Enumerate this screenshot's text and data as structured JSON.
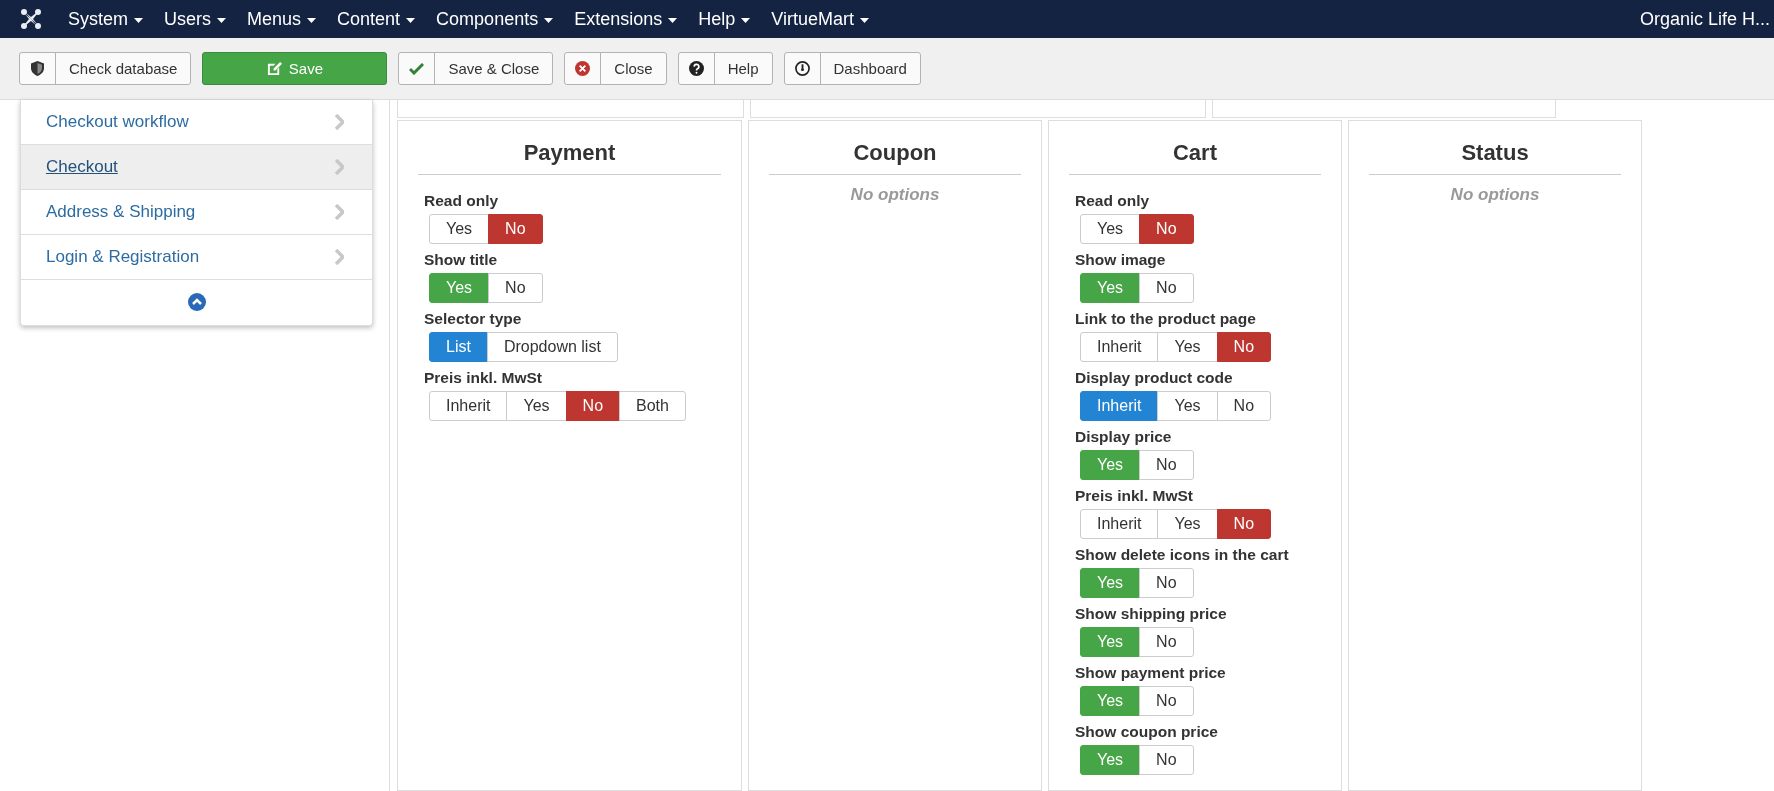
{
  "navbar": {
    "menus": [
      {
        "label": "System"
      },
      {
        "label": "Users"
      },
      {
        "label": "Menus"
      },
      {
        "label": "Content"
      },
      {
        "label": "Components"
      },
      {
        "label": "Extensions"
      },
      {
        "label": "Help"
      },
      {
        "label": "VirtueMart"
      }
    ],
    "site_name": "Organic Life H..."
  },
  "toolbar": [
    {
      "label": "Check database",
      "kind": "default"
    },
    {
      "label": "Save",
      "kind": "primary"
    },
    {
      "label": "Save & Close",
      "kind": "default"
    },
    {
      "label": "Close",
      "kind": "default"
    },
    {
      "label": "Help",
      "kind": "default"
    },
    {
      "label": "Dashboard",
      "kind": "default"
    }
  ],
  "sidebar": {
    "items": [
      {
        "label": "Checkout workflow",
        "selected": false
      },
      {
        "label": "Checkout",
        "selected": true
      },
      {
        "label": "Address & Shipping",
        "selected": false
      },
      {
        "label": "Login & Registration",
        "selected": false
      }
    ]
  },
  "panels": [
    {
      "title": "Payment",
      "options": [
        {
          "label": "Read only",
          "choices": [
            {
              "label": "Yes",
              "selected": false
            },
            {
              "label": "No",
              "kind": "no",
              "selected": true
            }
          ]
        },
        {
          "label": "Show title",
          "choices": [
            {
              "label": "Yes",
              "kind": "yes",
              "selected": true
            },
            {
              "label": "No",
              "selected": false
            }
          ]
        },
        {
          "label": "Selector type",
          "choices": [
            {
              "label": "List",
              "kind": "neutral",
              "selected": true
            },
            {
              "label": "Dropdown list",
              "selected": false
            }
          ]
        },
        {
          "label": "Preis inkl. MwSt",
          "choices": [
            {
              "label": "Inherit",
              "selected": false
            },
            {
              "label": "Yes",
              "selected": false
            },
            {
              "label": "No",
              "kind": "no",
              "selected": true
            },
            {
              "label": "Both",
              "selected": false
            }
          ]
        }
      ]
    },
    {
      "title": "Coupon",
      "empty_text": "No options"
    },
    {
      "title": "Cart",
      "options": [
        {
          "label": "Read only",
          "choices": [
            {
              "label": "Yes",
              "selected": false
            },
            {
              "label": "No",
              "kind": "no",
              "selected": true
            }
          ]
        },
        {
          "label": "Show image",
          "choices": [
            {
              "label": "Yes",
              "kind": "yes",
              "selected": true
            },
            {
              "label": "No",
              "selected": false
            }
          ]
        },
        {
          "label": "Link to the product page",
          "choices": [
            {
              "label": "Inherit",
              "selected": false
            },
            {
              "label": "Yes",
              "selected": false
            },
            {
              "label": "No",
              "kind": "no",
              "selected": true
            }
          ]
        },
        {
          "label": "Display product code",
          "choices": [
            {
              "label": "Inherit",
              "kind": "neutral",
              "selected": true
            },
            {
              "label": "Yes",
              "selected": false
            },
            {
              "label": "No",
              "selected": false
            }
          ]
        },
        {
          "label": "Display price",
          "choices": [
            {
              "label": "Yes",
              "kind": "yes",
              "selected": true
            },
            {
              "label": "No",
              "selected": false
            }
          ]
        },
        {
          "label": "Preis inkl. MwSt",
          "choices": [
            {
              "label": "Inherit",
              "selected": false
            },
            {
              "label": "Yes",
              "selected": false
            },
            {
              "label": "No",
              "kind": "no",
              "selected": true
            }
          ]
        },
        {
          "label": "Show delete icons in the cart",
          "choices": [
            {
              "label": "Yes",
              "kind": "yes",
              "selected": true
            },
            {
              "label": "No",
              "selected": false
            }
          ]
        },
        {
          "label": "Show shipping price",
          "choices": [
            {
              "label": "Yes",
              "kind": "yes",
              "selected": true
            },
            {
              "label": "No",
              "selected": false
            }
          ]
        },
        {
          "label": "Show payment price",
          "choices": [
            {
              "label": "Yes",
              "kind": "yes",
              "selected": true
            },
            {
              "label": "No",
              "selected": false
            }
          ]
        },
        {
          "label": "Show coupon price",
          "choices": [
            {
              "label": "Yes",
              "kind": "yes",
              "selected": true
            },
            {
              "label": "No",
              "selected": false
            }
          ]
        }
      ]
    },
    {
      "title": "Status",
      "empty_text": "No options"
    }
  ]
}
